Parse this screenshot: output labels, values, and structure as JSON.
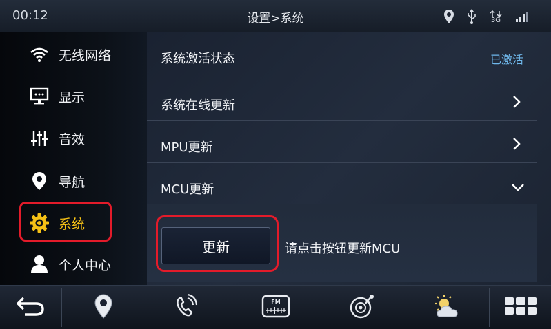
{
  "status_bar": {
    "time": "00:12",
    "title": "设置>系统",
    "icons": [
      "location-icon",
      "usb-icon",
      "network-3g-icon",
      "signal-icon"
    ],
    "network_type": "3G"
  },
  "sidebar": {
    "items": [
      {
        "label": "无线网络",
        "icon": "wifi-icon"
      },
      {
        "label": "显示",
        "icon": "display-icon"
      },
      {
        "label": "音效",
        "icon": "equalizer-icon"
      },
      {
        "label": "导航",
        "icon": "location-pin-icon"
      },
      {
        "label": "系统",
        "icon": "gear-icon"
      },
      {
        "label": "个人中心",
        "icon": "user-icon"
      }
    ],
    "active_index": 4,
    "active_color": "#f5c116"
  },
  "main": {
    "rows": [
      {
        "label": "系统激活状态",
        "value": "已激活"
      },
      {
        "label": "系统在线更新",
        "indicator": "chevron-right"
      },
      {
        "label": "MPU更新",
        "indicator": "chevron-right"
      },
      {
        "label": "MCU更新",
        "indicator": "chevron-down"
      }
    ],
    "mcu_panel": {
      "button_label": "更新",
      "hint": "请点击按钮更新MCU"
    }
  },
  "bottom_bar": {
    "items": [
      "back-icon",
      "navigation-icon",
      "phone-icon",
      "fm-radio-icon",
      "music-icon",
      "weather-icon",
      "app-grid-icon"
    ]
  },
  "colors": {
    "highlight": "#e31b2a",
    "value_text": "#6fb7ea",
    "accent": "#f5c116"
  }
}
